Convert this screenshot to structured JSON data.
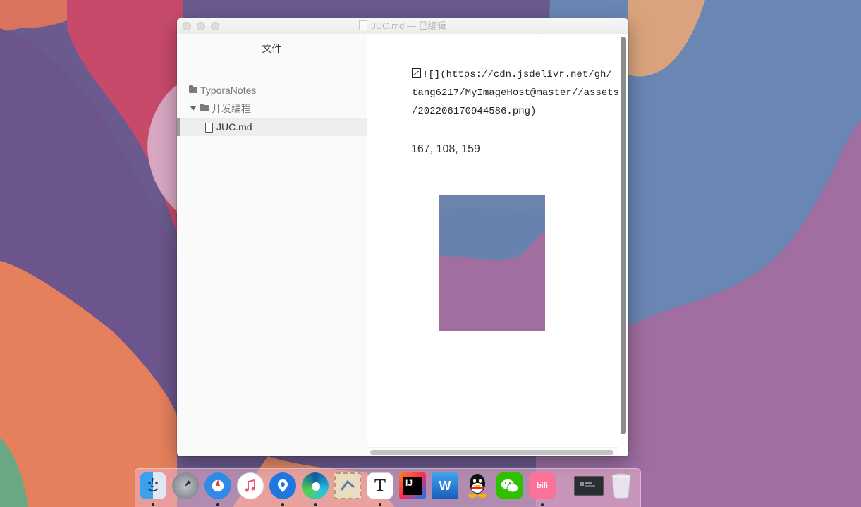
{
  "window": {
    "title": "JUC.md — 已编辑"
  },
  "sidebar": {
    "title": "文件",
    "items": [
      {
        "label": "TyporaNotes",
        "type": "folder"
      },
      {
        "label": "并发编程",
        "type": "folder-open"
      },
      {
        "label": "JUC.md",
        "type": "file",
        "selected": true
      }
    ]
  },
  "editor": {
    "source_lines": [
      "![](https://cdn.jsdelivr.net/gh/",
      "tang6217/MyImageHost@master//assets",
      "/202206170944586.png)"
    ],
    "rgb_text": "167, 108, 159"
  },
  "dock": {
    "apps": [
      {
        "name": "finder-icon",
        "running": true
      },
      {
        "name": "launchpad-icon",
        "running": false
      },
      {
        "name": "safari-icon",
        "running": true
      },
      {
        "name": "music-icon",
        "running": false
      },
      {
        "name": "pin-app-icon",
        "running": true
      },
      {
        "name": "edge-icon",
        "running": true
      },
      {
        "name": "mail-stamp-icon",
        "running": false
      },
      {
        "name": "typora-icon",
        "running": true
      },
      {
        "name": "intellij-icon",
        "running": false
      },
      {
        "name": "word-icon",
        "running": false
      },
      {
        "name": "qq-icon",
        "running": false
      },
      {
        "name": "wechat-icon",
        "running": false
      },
      {
        "name": "bilibili-icon",
        "running": true
      },
      {
        "name": "window-thumbnail-icon",
        "running": false
      },
      {
        "name": "trash-icon",
        "running": false
      }
    ],
    "labels": {
      "typora": "T",
      "intellij": "IJ",
      "word": "W",
      "bilibili": "bili"
    }
  },
  "colors": {
    "wallpaper_purple": "#6f5b8f",
    "wallpaper_blue": "#6a86b3",
    "wallpaper_pink": "#c94c6d",
    "wallpaper_orange": "#e8845c",
    "wallpaper_mauve": "#a16fa0",
    "image_blue": "#6682ad",
    "image_mauve": "#a16ea0"
  }
}
